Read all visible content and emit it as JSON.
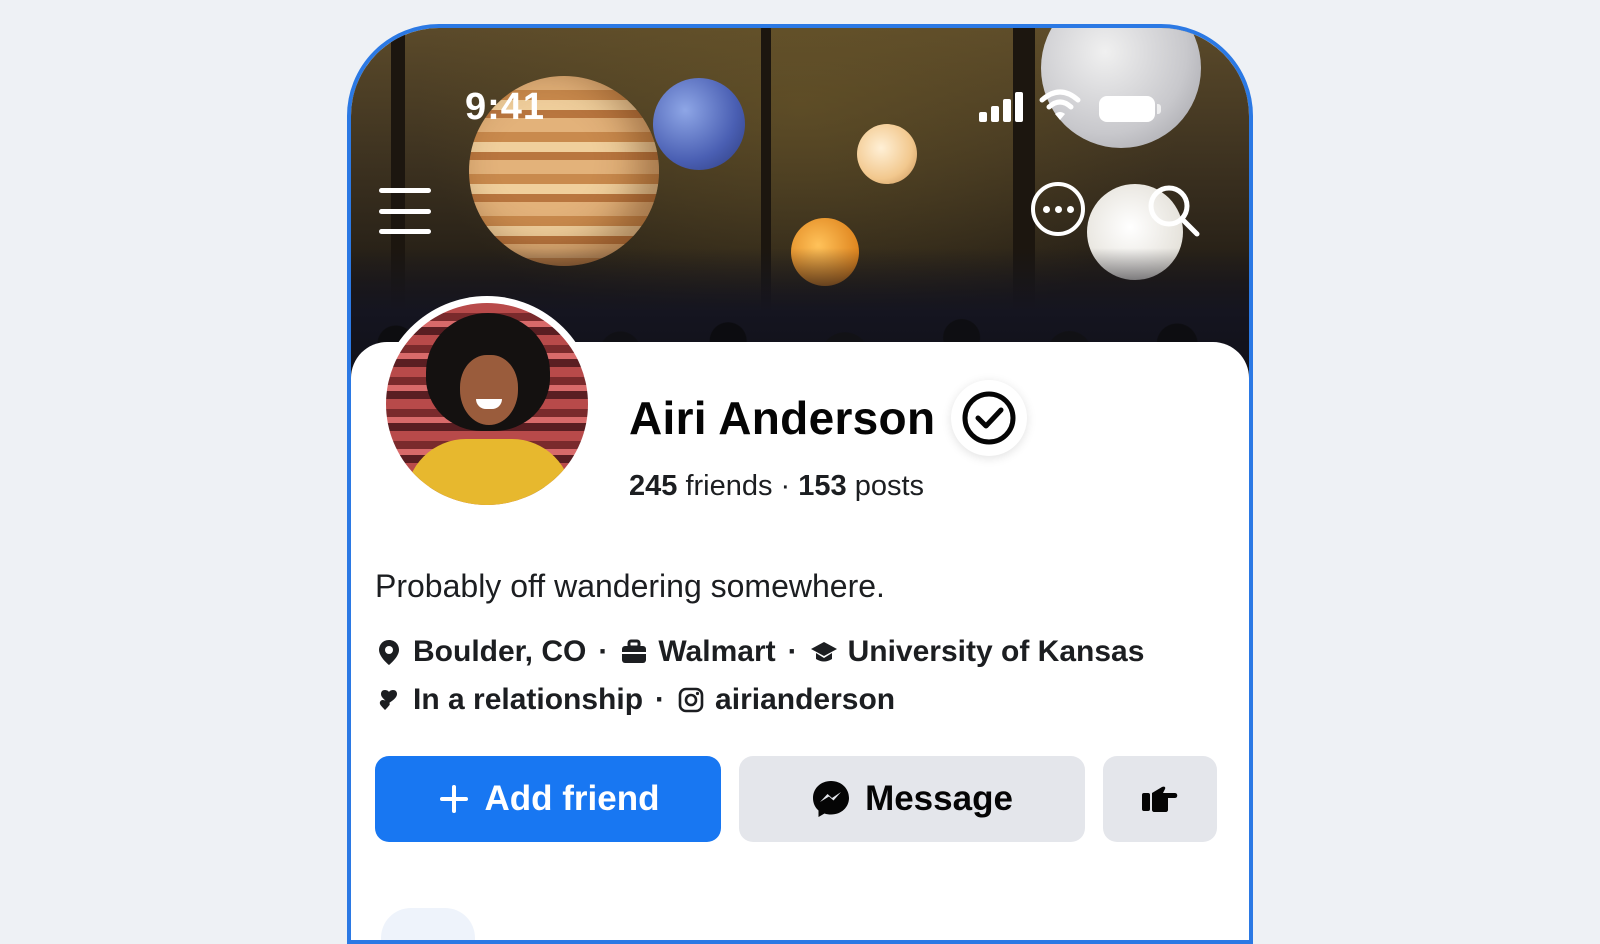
{
  "status_bar": {
    "time": "9:41",
    "icons": [
      "cellular-signal-icon",
      "wifi-icon",
      "battery-icon"
    ]
  },
  "header": {
    "menu_icon": "hamburger-menu-icon",
    "more_icon": "more-options-icon",
    "search_icon": "search-icon"
  },
  "profile": {
    "name": "Airi Anderson",
    "verified_icon": "verified-check-icon",
    "friends_count": "245",
    "friends_label": " friends · ",
    "posts_count": "153",
    "posts_label": " posts",
    "bio": "Probably off wandering somewhere."
  },
  "details": {
    "location": "Boulder, CO",
    "work": "Walmart",
    "education": "University of Kansas",
    "relationship": "In a relationship",
    "instagram": "airianderson",
    "separator": "·"
  },
  "actions": {
    "add_friend": "Add friend",
    "message": "Message"
  },
  "colors": {
    "accent": "#1877f2",
    "frame": "#2b79e4",
    "secondary_button": "#e4e6eb",
    "text": "#050505"
  }
}
